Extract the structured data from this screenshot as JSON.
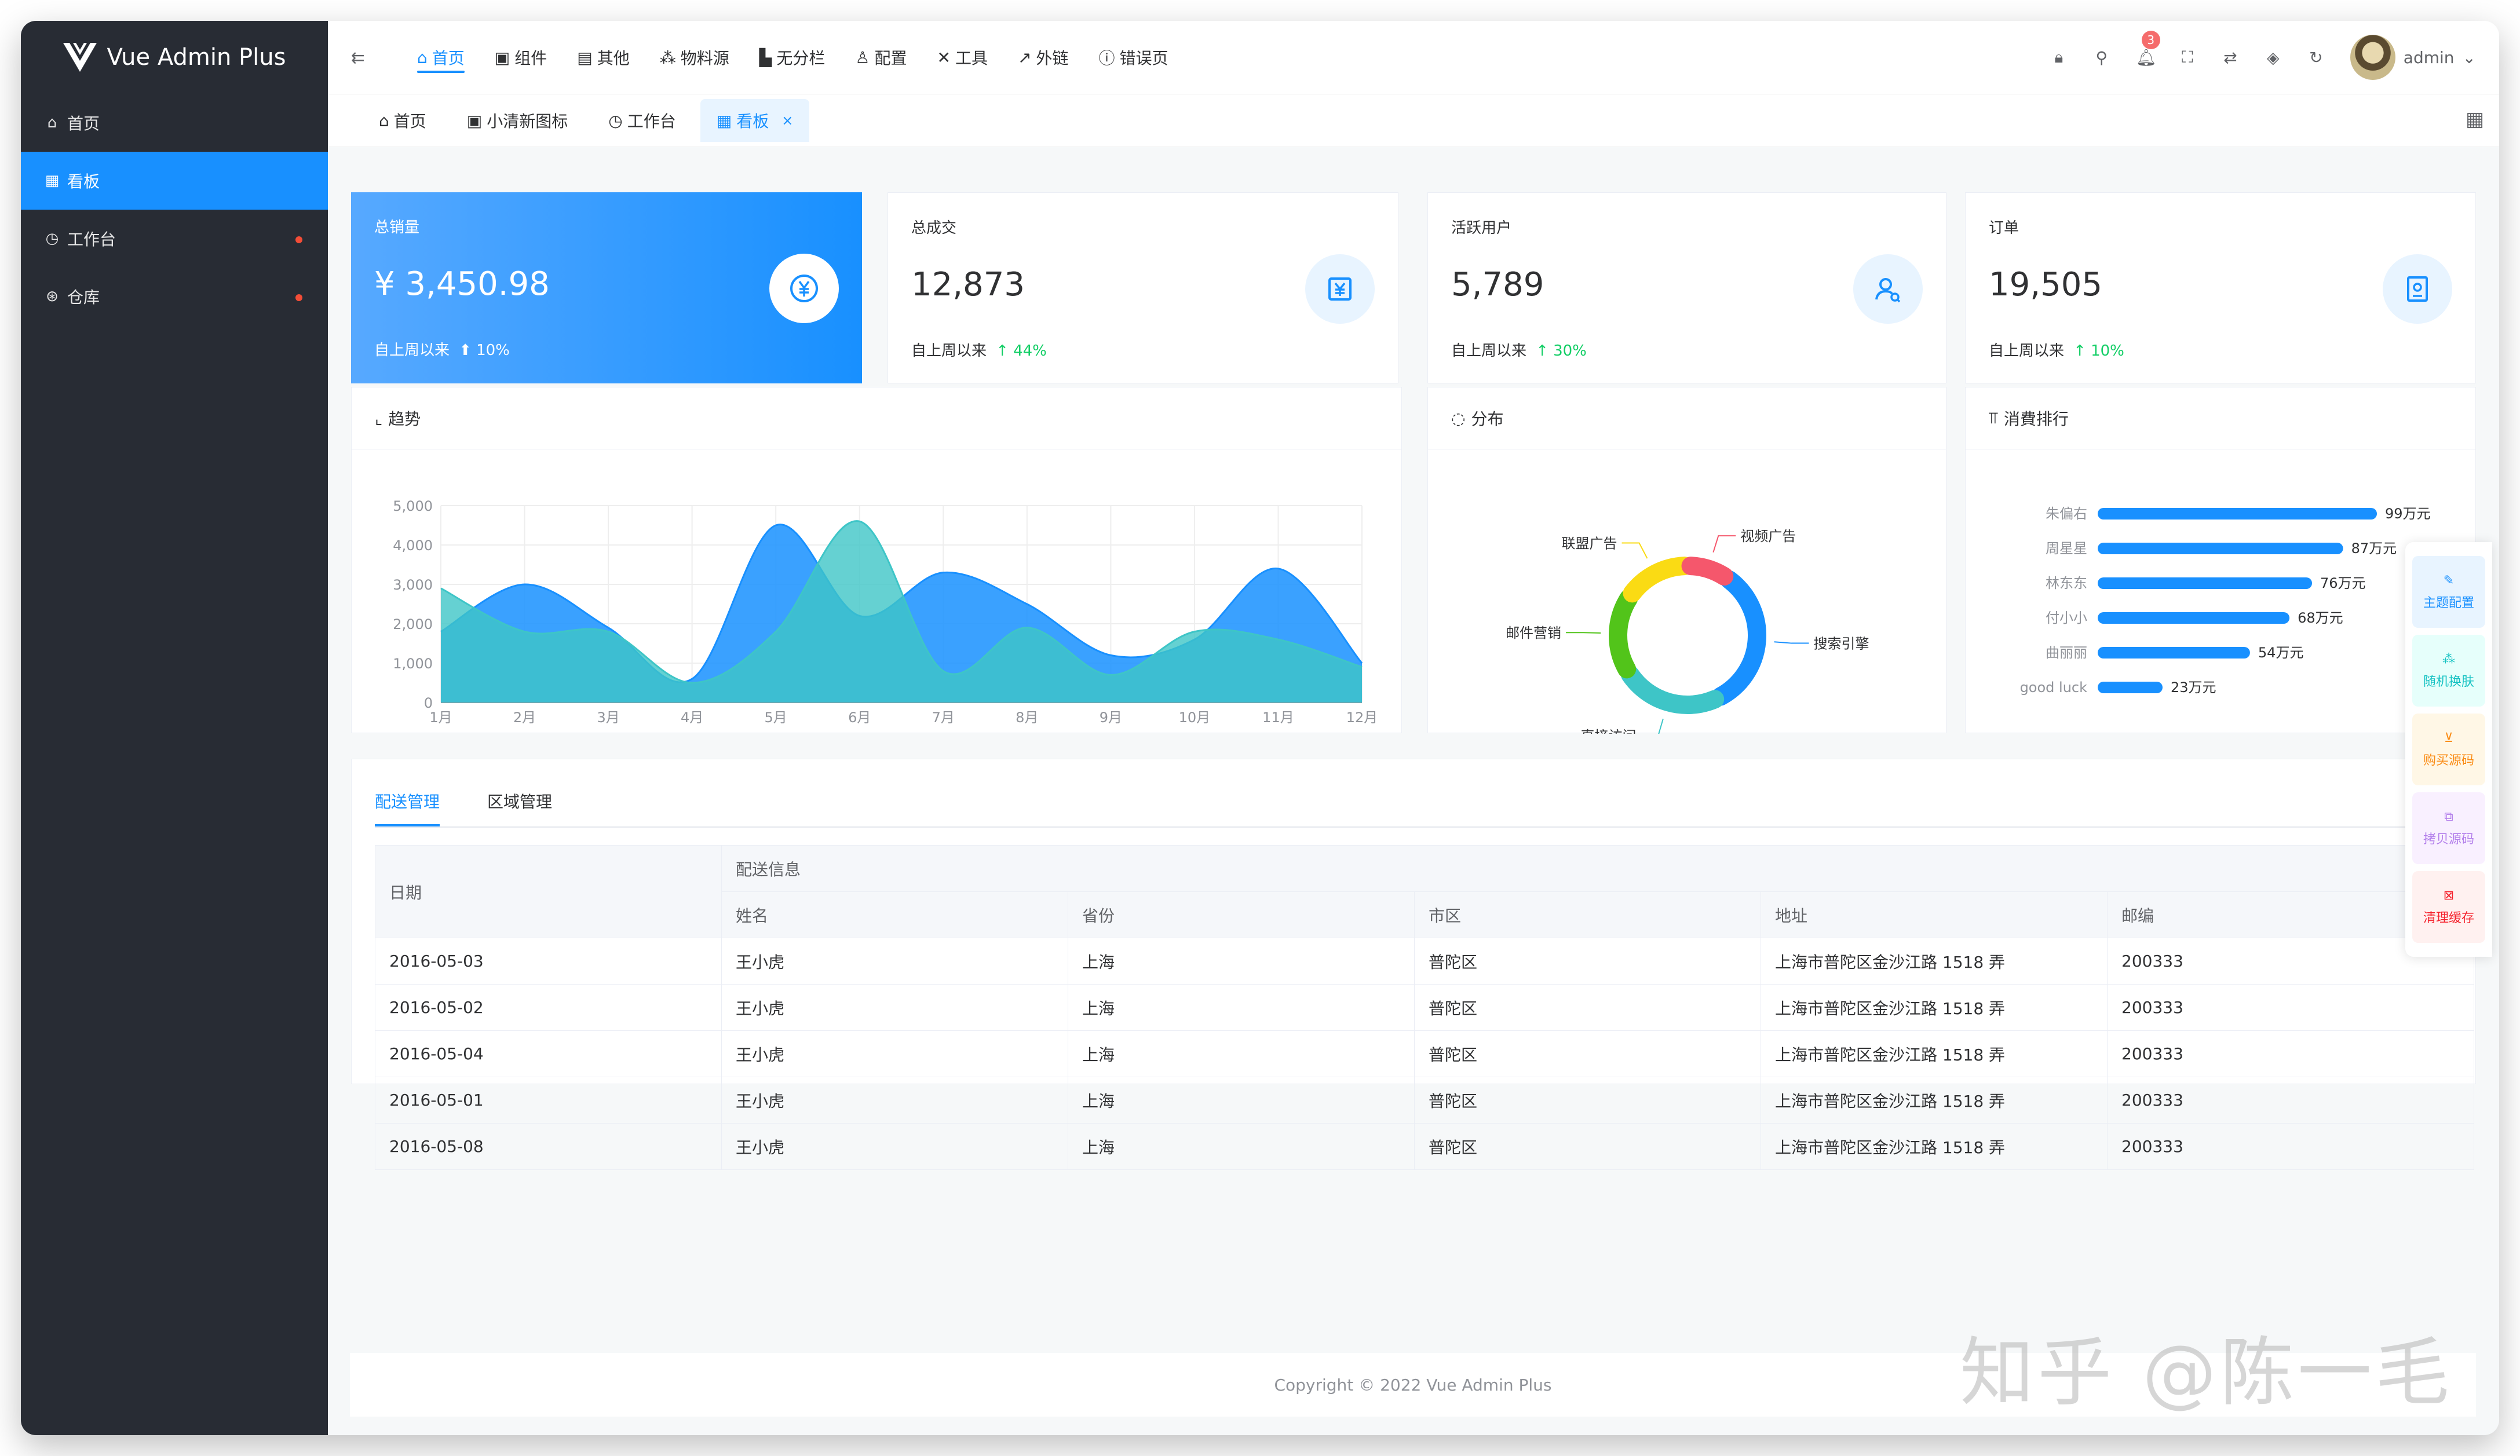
{
  "app": {
    "name": "Vue Admin Plus"
  },
  "sidebar": {
    "items": [
      {
        "icon": "⌂",
        "label": "首页",
        "active": false,
        "dot": false
      },
      {
        "icon": "▦",
        "label": "看板",
        "active": true,
        "dot": false
      },
      {
        "icon": "◷",
        "label": "工作台",
        "active": false,
        "dot": true
      },
      {
        "icon": "⊛",
        "label": "仓库",
        "active": false,
        "dot": true
      }
    ]
  },
  "header": {
    "nav": [
      {
        "icon": "⌂",
        "label": "首页"
      },
      {
        "icon": "▣",
        "label": "组件"
      },
      {
        "icon": "▤",
        "label": "其他"
      },
      {
        "icon": "⁂",
        "label": "物料源"
      },
      {
        "icon": "▙",
        "label": "无分栏"
      },
      {
        "icon": "♙",
        "label": "配置"
      },
      {
        "icon": "✕",
        "label": "工具"
      },
      {
        "icon": "↗",
        "label": "外链"
      },
      {
        "icon": "ⓘ",
        "label": "错误页"
      }
    ],
    "notification_count": "3",
    "username": "admin"
  },
  "tabs": [
    {
      "icon": "⌂",
      "label": "首页"
    },
    {
      "icon": "▣",
      "label": "小清新图标"
    },
    {
      "icon": "◷",
      "label": "工作台"
    },
    {
      "icon": "▦",
      "label": "看板"
    }
  ],
  "stats": [
    {
      "label": "总销量",
      "value": "¥ 3,450.98",
      "since": "自上周以来",
      "pct": "10%",
      "icon": "yen-circle"
    },
    {
      "label": "总成交",
      "value": "12,873",
      "since": "自上周以来",
      "pct": "44%",
      "icon": "yen-box"
    },
    {
      "label": "活跃用户",
      "value": "5,789",
      "since": "自上周以来",
      "pct": "30%",
      "icon": "user-search"
    },
    {
      "label": "订单",
      "value": "19,505",
      "since": "自上周以来",
      "pct": "10%",
      "icon": "order"
    }
  ],
  "panels": {
    "trend": "趋势",
    "distribution": "分布",
    "ranking": "消費排行"
  },
  "colors": {
    "primary": "#1890ff",
    "teal": "#3ec5c7",
    "sidebar": "#282c34",
    "up": "#13ce66"
  },
  "chart_data": [
    {
      "type": "area",
      "title": "趋势",
      "categories": [
        "1月",
        "2月",
        "3月",
        "4月",
        "5月",
        "6月",
        "7月",
        "8月",
        "9月",
        "10月",
        "11月",
        "12月"
      ],
      "ylim": [
        0,
        5000
      ],
      "yticks": [
        "0",
        "1,000",
        "2,000",
        "3,000",
        "4,000",
        "5,000"
      ],
      "series": [
        {
          "values": [
            1800,
            3000,
            1900,
            600,
            4500,
            2200,
            3300,
            2500,
            1200,
            1600,
            3400,
            1000
          ],
          "color": "#1890ff"
        },
        {
          "values": [
            2900,
            1800,
            1800,
            500,
            1800,
            4600,
            800,
            1900,
            700,
            1800,
            1600,
            900
          ],
          "color": "#3ec5c7"
        }
      ],
      "grid": true
    },
    {
      "type": "pie",
      "title": "分布",
      "categories": [
        "搜索引擎",
        "直接访问",
        "邮件营销",
        "联盟广告",
        "视频广告"
      ],
      "values": [
        1048,
        735,
        580,
        484,
        300
      ],
      "colors": [
        "#1890ff",
        "#3ec5c7",
        "#52c41a",
        "#fadb14",
        "#f5576c"
      ],
      "donut": true
    },
    {
      "type": "bar",
      "title": "消費排行",
      "categories": [
        "朱偏右",
        "周星星",
        "林东东",
        "付小小",
        "曲丽丽",
        "good luck"
      ],
      "values": [
        99,
        87,
        76,
        68,
        54,
        23
      ],
      "labels": [
        "99万元",
        "87万元",
        "76万元",
        "68万元",
        "54万元",
        "23万元"
      ],
      "xlim": [
        0,
        120
      ],
      "orientation": "horizontal"
    }
  ],
  "table": {
    "tabs": [
      "配送管理",
      "区域管理"
    ],
    "group_header": "配送信息",
    "headers": [
      "日期",
      "姓名",
      "省份",
      "市区",
      "地址",
      "邮编"
    ],
    "rows": [
      [
        "2016-05-03",
        "王小虎",
        "上海",
        "普陀区",
        "上海市普陀区金沙江路 1518 弄",
        "200333"
      ],
      [
        "2016-05-02",
        "王小虎",
        "上海",
        "普陀区",
        "上海市普陀区金沙江路 1518 弄",
        "200333"
      ],
      [
        "2016-05-04",
        "王小虎",
        "上海",
        "普陀区",
        "上海市普陀区金沙江路 1518 弄",
        "200333"
      ],
      [
        "2016-05-01",
        "王小虎",
        "上海",
        "普陀区",
        "上海市普陀区金沙江路 1518 弄",
        "200333"
      ],
      [
        "2016-05-08",
        "王小虎",
        "上海",
        "普陀区",
        "上海市普陀区金沙江路 1518 弄",
        "200333"
      ]
    ]
  },
  "right_tools": [
    {
      "label": "主题配置",
      "icon": "✎",
      "color": "#1890ff",
      "bg": "#e8f4ff"
    },
    {
      "label": "随机换肤",
      "icon": "⁂",
      "color": "#13c2c2",
      "bg": "#e6fffb"
    },
    {
      "label": "购买源码",
      "icon": "⊻",
      "color": "#fa8c16",
      "bg": "#fff7e6"
    },
    {
      "label": "拷贝源码",
      "icon": "⧉",
      "color": "#b37feb",
      "bg": "#f9f0ff"
    },
    {
      "label": "清理缓存",
      "icon": "⊠",
      "color": "#f5222d",
      "bg": "#fff1f0"
    }
  ],
  "footer": {
    "copyright": "Copyright © 2022 Vue Admin Plus"
  },
  "watermark": "知乎 @陈一毛"
}
